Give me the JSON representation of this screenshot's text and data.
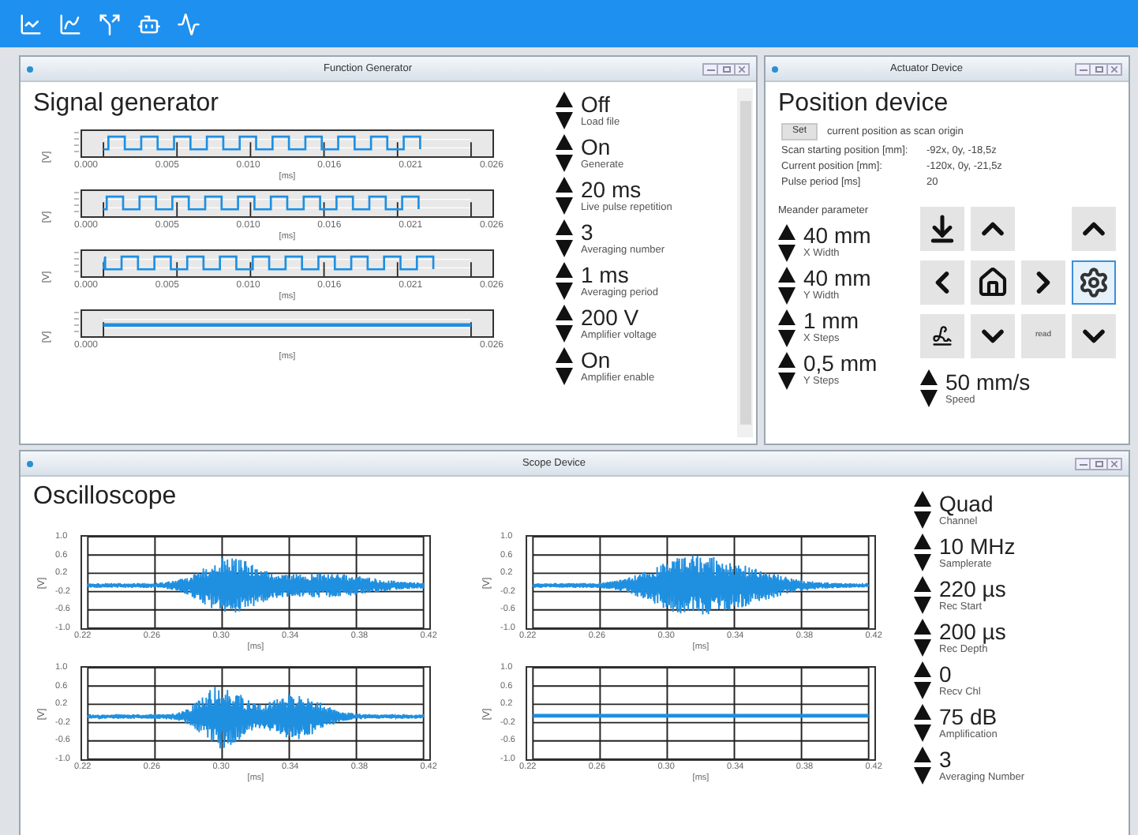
{
  "function_generator": {
    "title": "Function Generator",
    "heading": "Signal generator",
    "plots": [
      {
        "kind": "square",
        "y_label": "[V]",
        "x_ticks": [
          "0.000",
          "0.005",
          "0.010",
          "0.016",
          "0.021",
          "0.026"
        ],
        "x_label": "[ms]"
      },
      {
        "kind": "square",
        "y_label": "[V]",
        "x_ticks": [
          "0.000",
          "0.005",
          "0.010",
          "0.016",
          "0.021",
          "0.026"
        ],
        "x_label": "[ms]"
      },
      {
        "kind": "square",
        "y_label": "[V]",
        "x_ticks": [
          "0.000",
          "0.005",
          "0.010",
          "0.016",
          "0.021",
          "0.026"
        ],
        "x_label": "[ms]"
      },
      {
        "kind": "flat",
        "y_label": "[V]",
        "x_ticks": [
          "0.000",
          "0.026"
        ],
        "x_label": "[ms]"
      }
    ],
    "controls": [
      {
        "value": "Off",
        "label": "Load file"
      },
      {
        "value": "On",
        "label": "Generate"
      },
      {
        "value": "20 ms",
        "label": "Live pulse repetition"
      },
      {
        "value": "3",
        "label": "Averaging number"
      },
      {
        "value": "1 ms",
        "label": "Averaging period"
      },
      {
        "value": "200 V",
        "label": "Amplifier voltage"
      },
      {
        "value": "On",
        "label": "Amplifier enable"
      }
    ]
  },
  "actuator": {
    "title": "Actuator Device",
    "heading": "Position device",
    "set_button": "Set",
    "set_text": "current position as scan origin",
    "info": [
      {
        "label": "Scan starting position [mm]:",
        "value": "-92x, 0y, -18,5z"
      },
      {
        "label": "Current position [mm]:",
        "value": "-120x, 0y, -21,5z"
      },
      {
        "label": "Pulse period [ms]",
        "value": "20"
      }
    ],
    "meander_label": "Meander parameter",
    "params": [
      {
        "value": "40 mm",
        "label": "X Width"
      },
      {
        "value": "40 mm",
        "label": "Y Width"
      },
      {
        "value": "1 mm",
        "label": "X Steps"
      },
      {
        "value": "0,5 mm",
        "label": "Y Steps"
      }
    ],
    "speed": {
      "value": "50 mm/s",
      "label": "Speed"
    },
    "buttons": [
      {
        "kind": "download",
        "selected": false
      },
      {
        "kind": "up",
        "selected": false
      },
      {
        "kind": "up",
        "selected": false
      },
      {
        "kind": "left",
        "selected": false
      },
      {
        "kind": "home",
        "selected": false
      },
      {
        "kind": "right",
        "selected": false
      },
      {
        "kind": "gear",
        "selected": true
      },
      {
        "kind": "scribble",
        "selected": false
      },
      {
        "kind": "down",
        "selected": false
      },
      {
        "kind": "text",
        "label": "read",
        "selected": false
      },
      {
        "kind": "down",
        "selected": false
      }
    ]
  },
  "scope": {
    "title": "Scope Device",
    "heading": "Oscilloscope",
    "plots": [
      {
        "kind": "burst",
        "y_label": "[V]",
        "y_ticks": [
          "1.0",
          "0.6",
          "0.2",
          "-0.2",
          "-0.6",
          "-1.0"
        ],
        "x_ticks": [
          "0.22",
          "0.26",
          "0.30",
          "0.34",
          "0.38",
          "0.42"
        ],
        "x_label": "[ms]"
      },
      {
        "kind": "burst",
        "y_label": "[V]",
        "y_ticks": [
          "1.0",
          "0.6",
          "0.2",
          "-0.2",
          "-0.6",
          "-1.0"
        ],
        "x_ticks": [
          "0.22",
          "0.26",
          "0.30",
          "0.34",
          "0.38",
          "0.42"
        ],
        "x_label": "[ms]"
      },
      {
        "kind": "burst",
        "y_label": "[V]",
        "y_ticks": [
          "1.0",
          "0.6",
          "0.2",
          "-0.2",
          "-0.6",
          "-1.0"
        ],
        "x_ticks": [
          "0.22",
          "0.26",
          "0.30",
          "0.34",
          "0.38",
          "0.42"
        ],
        "x_label": "[ms]"
      },
      {
        "kind": "flat",
        "y_label": "[V]",
        "y_ticks": [
          "1.0",
          "0.6",
          "0.2",
          "-0.2",
          "-0.6",
          "-1.0"
        ],
        "x_ticks": [
          "0.22",
          "0.26",
          "0.30",
          "0.34",
          "0.38",
          "0.42"
        ],
        "x_label": "[ms]"
      }
    ],
    "controls": [
      {
        "value": "Quad",
        "label": "Channel"
      },
      {
        "value": "10 MHz",
        "label": "Samplerate"
      },
      {
        "value": "220 µs",
        "label": "Rec Start"
      },
      {
        "value": "200 µs",
        "label": "Rec Depth"
      },
      {
        "value": "0",
        "label": "Recv Chl"
      },
      {
        "value": "75 dB",
        "label": "Amplification"
      },
      {
        "value": "3",
        "label": "Averaging Number"
      }
    ]
  }
}
